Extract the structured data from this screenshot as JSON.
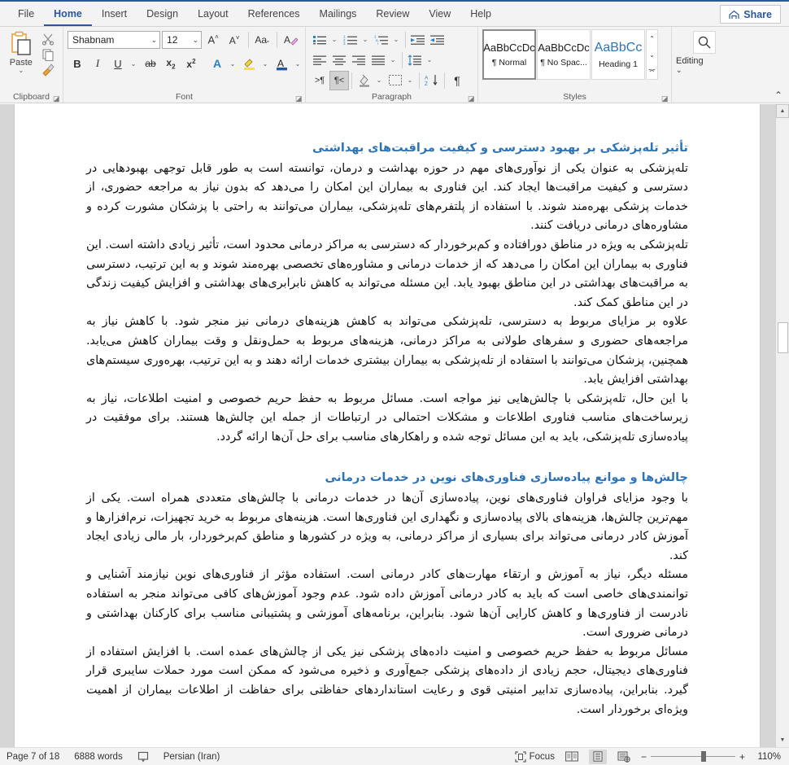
{
  "window": {
    "tabs": [
      {
        "label": "File",
        "active": false
      },
      {
        "label": "Home",
        "active": true
      },
      {
        "label": "Insert",
        "active": false
      },
      {
        "label": "Design",
        "active": false
      },
      {
        "label": "Layout",
        "active": false
      },
      {
        "label": "References",
        "active": false
      },
      {
        "label": "Mailings",
        "active": false
      },
      {
        "label": "Review",
        "active": false
      },
      {
        "label": "View",
        "active": false
      },
      {
        "label": "Help",
        "active": false
      }
    ],
    "share_label": "Share",
    "share_icon": "share-icon"
  },
  "ribbon": {
    "clipboard": {
      "label": "Clipboard",
      "paste_label": "Paste",
      "paste_icon": "paste-icon",
      "cut_icon": "scissors-icon",
      "copy_icon": "copy-icon",
      "format_painter_icon": "format-painter-icon",
      "launcher_icon": "dialog-launcher-icon"
    },
    "font": {
      "label": "Font",
      "font_name": "Shabnam",
      "font_size": "12",
      "grow_font_icon": "grow-font-icon",
      "shrink_font_icon": "shrink-font-icon",
      "change_case_icon": "change-case-icon",
      "clear_formatting_icon": "clear-formatting-icon",
      "bold_label": "B",
      "italic_label": "I",
      "underline_label": "U",
      "strikethrough_label": "ab",
      "subscript_label": "x",
      "superscript_label": "x",
      "text_effects_icon": "text-effects-icon",
      "highlight_icon": "text-highlight-icon",
      "font_color_icon": "font-color-icon",
      "launcher_icon": "dialog-launcher-icon"
    },
    "paragraph": {
      "label": "Paragraph",
      "bullets_icon": "bullets-icon",
      "numbering_icon": "numbering-icon",
      "multilevel_icon": "multilevel-list-icon",
      "decrease_indent_icon": "decrease-indent-icon",
      "increase_indent_icon": "increase-indent-icon",
      "align_left_icon": "align-left-icon",
      "align_center_icon": "align-center-icon",
      "align_right_icon": "align-right-icon",
      "justify_icon": "justify-icon",
      "line_spacing_icon": "line-spacing-icon",
      "ltr_icon": "left-to-right-text-icon",
      "rtl_icon": "right-to-left-text-icon",
      "rtl_active": true,
      "shading_icon": "shading-icon",
      "borders_icon": "borders-icon",
      "sort_icon": "sort-icon",
      "show_marks_icon": "show-paragraph-marks-icon",
      "launcher_icon": "dialog-launcher-icon"
    },
    "styles": {
      "label": "Styles",
      "items": [
        {
          "preview": "AaBbCcDc",
          "name": "¶ Normal",
          "selected": true
        },
        {
          "preview": "AaBbCcDc",
          "name": "¶ No Spac...",
          "selected": false
        },
        {
          "preview": "AaBbCc",
          "name": "Heading 1",
          "selected": false
        }
      ],
      "scroll_up_icon": "scroll-up-icon",
      "scroll_down_icon": "scroll-down-icon",
      "more_icon": "more-styles-icon",
      "launcher_icon": "dialog-launcher-icon"
    },
    "editing": {
      "label": "Editing",
      "icon": "search-icon",
      "chevron_icon": "chevron-down-icon"
    },
    "collapse_icon": "collapse-ribbon-icon"
  },
  "document": {
    "sections": [
      {
        "heading": "تأثیر تله‌پزشکی بر بهبود دسترسی و کیفیت مراقبت‌های بهداشتی",
        "paragraphs": [
          "تله‌پزشکی به عنوان یکی از نوآوری‌های مهم در حوزه بهداشت و درمان، توانسته است به طور قابل توجهی بهبودهایی در دسترسی و کیفیت مراقبت‌ها ایجاد کند. این فناوری به بیماران این امکان را می‌دهد که بدون نیاز به مراجعه حضوری، از خدمات پزشکی بهره‌مند شوند. با استفاده از پلتفرم‌های تله‌پزشکی، بیماران می‌توانند به راحتی با پزشکان مشورت کرده و مشاوره‌های درمانی دریافت کنند.",
          "تله‌پزشکی به ویژه در مناطق دورافتاده و کم‌برخوردار که دسترسی به مراکز درمانی محدود است، تأثیر زیادی داشته است. این فناوری به بیماران این امکان را می‌دهد که از خدمات درمانی و مشاوره‌های تخصصی بهره‌مند شوند و به این ترتیب، دسترسی به مراقبت‌های بهداشتی در این مناطق بهبود یابد. این مسئله می‌تواند به کاهش نابرابری‌های بهداشتی و افزایش کیفیت زندگی در این مناطق کمک کند.",
          "علاوه بر مزایای مربوط به دسترسی، تله‌پزشکی می‌تواند به کاهش هزینه‌های درمانی نیز منجر شود. با کاهش نیاز به مراجعه‌های حضوری و سفرهای طولانی به مراکز درمانی، هزینه‌های مربوط به حمل‌ونقل و وقت بیماران کاهش می‌یابد. همچنین، پزشکان می‌توانند با استفاده از تله‌پزشکی به بیماران بیشتری خدمات ارائه دهند و به این ترتیب، بهره‌وری سیستم‌های بهداشتی افزایش یابد.",
          "با این حال، تله‌پزشکی با چالش‌هایی نیز مواجه است. مسائل مربوط به حفظ حریم خصوصی و امنیت اطلاعات، نیاز به زیرساخت‌های مناسب فناوری اطلاعات و مشکلات احتمالی در ارتباطات از جمله این چالش‌ها هستند. برای موفقیت در پیاده‌سازی تله‌پزشکی، باید به این مسائل توجه شده و راهکارهای مناسب برای حل آن‌ها ارائه گردد."
        ]
      },
      {
        "heading": "چالش‌ها و موانع پیاده‌سازی فناوری‌های نوین در خدمات درمانی",
        "paragraphs": [
          "با وجود مزایای فراوان فناوری‌های نوین، پیاده‌سازی آن‌ها در خدمات درمانی با چالش‌های متعددی همراه است. یکی از مهم‌ترین چالش‌ها، هزینه‌های بالای پیاده‌سازی و نگهداری این فناوری‌ها است. هزینه‌های مربوط به خرید تجهیزات، نرم‌افزارها و آموزش کادر درمانی می‌تواند برای بسیاری از مراکز درمانی، به ویژه در کشورها و مناطق کم‌برخوردار، بار مالی زیادی ایجاد کند.",
          "مسئله دیگر، نیاز به آموزش و ارتقاء مهارت‌های کادر درمانی است. استفاده مؤثر از فناوری‌های نوین نیازمند آشنایی و توانمندی‌های خاصی است که باید به کادر درمانی آموزش داده شود. عدم وجود آموزش‌های کافی می‌تواند منجر به استفاده نادرست از فناوری‌ها و کاهش کارایی آن‌ها شود. بنابراین، برنامه‌های آموزشی و پشتیبانی مناسب برای کارکنان بهداشتی و درمانی ضروری است.",
          "مسائل مربوط به حفظ حریم خصوصی و امنیت داده‌های پزشکی نیز یکی از چالش‌های عمده است. با افزایش استفاده از فناوری‌های دیجیتال، حجم زیادی از داده‌های پزشکی جمع‌آوری و ذخیره می‌شود که ممکن است مورد حملات سایبری قرار گیرد. بنابراین، پیاده‌سازی تدابیر امنیتی قوی و رعایت استانداردهای حفاظتی برای حفاظت از اطلاعات بیماران از اهمیت ویژه‌ای برخوردار است."
        ]
      }
    ]
  },
  "statusbar": {
    "page_info": "Page 7 of 18",
    "word_count": "6888 words",
    "proofing_icon": "proofing-errors-icon",
    "language": "Persian (Iran)",
    "focus_label": "Focus",
    "focus_icon": "focus-mode-icon",
    "read_mode_icon": "read-mode-icon",
    "print_layout_icon": "print-layout-icon",
    "web_layout_icon": "web-layout-icon",
    "zoom_out_label": "−",
    "zoom_in_label": "+",
    "zoom_level": "110%"
  },
  "colors": {
    "accent": "#2b579a",
    "heading": "#2e74b5",
    "ribbon_bg": "#f3f3f3"
  }
}
